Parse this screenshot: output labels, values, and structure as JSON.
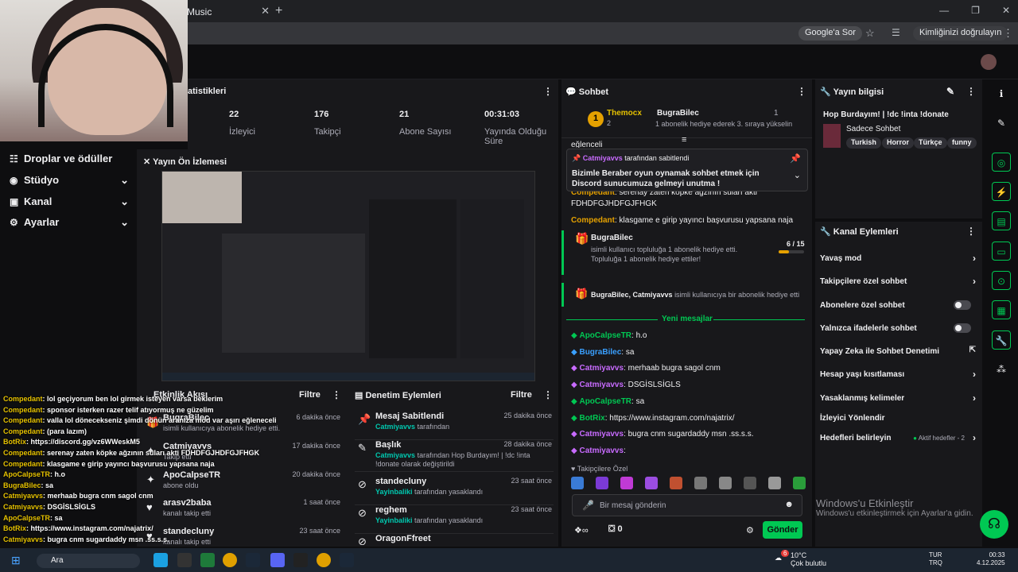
{
  "browser": {
    "tab_title": "Music",
    "google_sor": "Google'a Sor",
    "verify": "Kimliğinizi doğrulayın"
  },
  "sidebar": {
    "items": [
      {
        "label": "Droplar ve ödüller",
        "icon": "gift-icon"
      },
      {
        "label": "Stüdyo",
        "icon": "studio-icon"
      },
      {
        "label": "Kanal",
        "icon": "channel-icon"
      },
      {
        "label": "Ayarlar",
        "icon": "gear-icon"
      }
    ]
  },
  "stats": {
    "title": "atistikleri",
    "items": [
      {
        "value": "22",
        "label": "İzleyici"
      },
      {
        "value": "176",
        "label": "Takipçi"
      },
      {
        "value": "21",
        "label": "Abone Sayısı"
      },
      {
        "value": "00:31:03",
        "label": "Yayında Olduğu Süre"
      }
    ]
  },
  "preview": {
    "title": "Yayın Ön İzlemesi"
  },
  "feed": {
    "title": "Etkinlik Akışı",
    "filter": "Filtre",
    "items": [
      {
        "name": "BugraBilec",
        "sub": "isimli kullanıcıya abonelik hediye etti.",
        "time": "6 dakika önce"
      },
      {
        "name": "Catmiyavvs",
        "sub": "Takip etti",
        "time": "17 dakika önce"
      },
      {
        "name": "ApoCalpseTR",
        "sub": "abone oldu",
        "time": "20 dakika önce"
      },
      {
        "name": "arasv2baba",
        "sub": "kanalı takip etti",
        "time": "1 saat önce"
      },
      {
        "name": "standecluny",
        "sub": "kanalı takip etti",
        "time": "23 saat önce"
      }
    ]
  },
  "mod": {
    "title": "Denetim Eylemleri",
    "filter": "Filtre",
    "items": [
      {
        "name": "Mesaj Sabitlendi",
        "user": "Catmiyavvs",
        "sub": "tarafından",
        "time": "25 dakika önce"
      },
      {
        "name": "Başlık",
        "user": "Catmiyavvs",
        "sub": "tarafından Hop Burdayım! | !dc !inta !donate olarak değiştirildi",
        "time": "28 dakika önce"
      },
      {
        "name": "standecluny",
        "user": "Yayinbaliki",
        "sub": "tarafından yasaklandı",
        "time": "23 saat önce"
      },
      {
        "name": "reghem",
        "user": "Yayinbaliki",
        "sub": "tarafından yasaklandı",
        "time": "23 saat önce"
      },
      {
        "name": "OragonFfreet",
        "user": "",
        "sub": "",
        "time": ""
      }
    ]
  },
  "overlay_chat": [
    {
      "n": "Compedant",
      "t": ": lol geçiyorum ben lol girmek isteyen varsa beklerim"
    },
    {
      "n": "Compedant",
      "t": ": sponsor isterken razer telif atıyormuş ne güzelim"
    },
    {
      "n": "Compedant",
      "t": ": valla lol dönecekseniz şimdi dönün aranıza mod var aşırı eğleneceli"
    },
    {
      "n": "Compedant",
      "t": ": (para lazım)"
    },
    {
      "n": "BotRix",
      "t": ": https://discord.gg/vz6WWeskM5"
    },
    {
      "n": "Compedant",
      "t": ": serenay zaten köpke ağzının suları akti FDHDFGJHDFGJFHGK"
    },
    {
      "n": "Compedant",
      "t": ": klasgame e girip yayıncı başvurusu yapsana naja"
    },
    {
      "n": "ApoCalpseTR",
      "t": ": h.o"
    },
    {
      "n": "BugraBilec",
      "t": ": sa"
    },
    {
      "n": "Catmiyavvs",
      "t": ": merhaab bugra cnm sagol cnm"
    },
    {
      "n": "Catmiyavvs",
      "t": ": DSGİSLSİGLS"
    },
    {
      "n": "ApoCalpseTR",
      "t": ": sa"
    },
    {
      "n": "BotRix",
      "t": ": https://www.instagram.com/najatrix/"
    },
    {
      "n": "Catmiyavvs",
      "t": ": bugra cnm sugardaddy msn .ss.s.s."
    }
  ],
  "chat": {
    "title": "Sohbet",
    "hype": {
      "user1": "Themocx",
      "user1_count": "2",
      "user2": "BugraBilec",
      "user2_count": "1",
      "rank": "1",
      "text": "1 abonelik hediye ederek 3. sıraya yükselin"
    },
    "partial_top": "eğlenceli",
    "pinned": {
      "by": "Catmiyavvs",
      "by_suffix": "tarafından sabitlendi",
      "text": "Bizimle Beraber oyun oynamak sohbet etmek için Discord sunucumuza gelmeyi unutma !"
    },
    "pre_lines": [
      {
        "n": "Compedant",
        "t": ": serenay zaten köpke ağzının suları akti FDHDFGJHDFGJFHGK"
      },
      {
        "n": "Compedant",
        "t": ": klasgame e girip yayıncı başvurusu yapsana naja"
      }
    ],
    "gift": {
      "user": "BugraBilec",
      "text": "isimli kullanıcı topluluğa 1 abonelik hediye etti. Topluluğa 1 abonelik hediye ettiler!",
      "progress_current": "6",
      "progress_total": "15",
      "progress_fraction": 0.4
    },
    "gift2": {
      "users": "BugraBilec, Catmiyavvs",
      "text": "isimli kullanıcıya bir abonelik hediye etti"
    },
    "new_messages": "Yeni mesajlar",
    "lines": [
      {
        "n": "ApoCalpseTR",
        "t": ": h.o",
        "color": "#00c853"
      },
      {
        "n": "BugraBilec",
        "t": ": sa",
        "color": "#3aa0ff"
      },
      {
        "n": "Catmiyavvs",
        "t": ": merhaab bugra sagol cnm",
        "color": "#c86bff"
      },
      {
        "n": "Catmiyavvs",
        "t": ": DSGİSLSİGLS",
        "color": "#c86bff"
      },
      {
        "n": "ApoCalpseTR",
        "t": ": sa",
        "color": "#00c853"
      },
      {
        "n": "BotRix",
        "t": ": https://www.instagram.com/najatrix/",
        "color": "#00c853"
      },
      {
        "n": "Catmiyavvs",
        "t": ": bugra cnm sugardaddy msn .ss.s.s.",
        "color": "#c86bff"
      },
      {
        "n": "Catmiyavvs",
        "t": ":",
        "color": "#c86bff"
      }
    ],
    "followers_only": "Takipçilere Özel",
    "input_placeholder": "Bir mesaj gönderin",
    "points": "0",
    "send": "Gönder",
    "emote_colors": [
      "#3a7bd5",
      "#7b3ad5",
      "#c03ad5",
      "#9b4de0",
      "#c05030",
      "#777",
      "#888",
      "#555",
      "#999",
      "#2a9d3a"
    ]
  },
  "stream_info": {
    "title": "Yayın bilgisi",
    "stream_title": "Hop Burdayım! | !dc !inta !donate",
    "category": "Sadece Sohbet",
    "tags": [
      "Turkish",
      "Horror",
      "Türkçe",
      "funny"
    ]
  },
  "channel_actions": {
    "title": "Kanal Eylemleri",
    "items": [
      {
        "label": "Yavaş mod",
        "control": "chevron"
      },
      {
        "label": "Takipçilere özel sohbet",
        "control": "chevron"
      },
      {
        "label": "Abonelere özel sohbet",
        "control": "toggle"
      },
      {
        "label": "Yalnızca ifadelerle sohbet",
        "control": "toggle"
      },
      {
        "label": "Yapay Zeka ile Sohbet Denetimi",
        "control": "external"
      },
      {
        "label": "Hesap yaşı kısıtlaması",
        "control": "chevron"
      },
      {
        "label": "Yasaklanmış kelimeler",
        "control": "chevron"
      },
      {
        "label": "İzleyici Yönlendir",
        "control": "none"
      },
      {
        "label": "Hedefleri belirleyin",
        "control": "chevron",
        "extra": "Aktif hedefler - 2"
      }
    ]
  },
  "windows_activate": {
    "title": "Windows'u Etkinleştir",
    "sub": "Windows'u etkinleştirmek için Ayarlar'a gidin."
  },
  "taskbar": {
    "search": "Ara",
    "weather_temp": "10°C",
    "weather_desc": "Çok bulutlu",
    "lang1": "TUR",
    "lang2": "TRQ",
    "time": "00:33",
    "date": "4.12.2025",
    "badge_count": "6"
  },
  "colors": {
    "accent": "#00c853",
    "bg": "#0e0e10",
    "panel": "#18181b",
    "name_yellow": "#e5c100"
  }
}
